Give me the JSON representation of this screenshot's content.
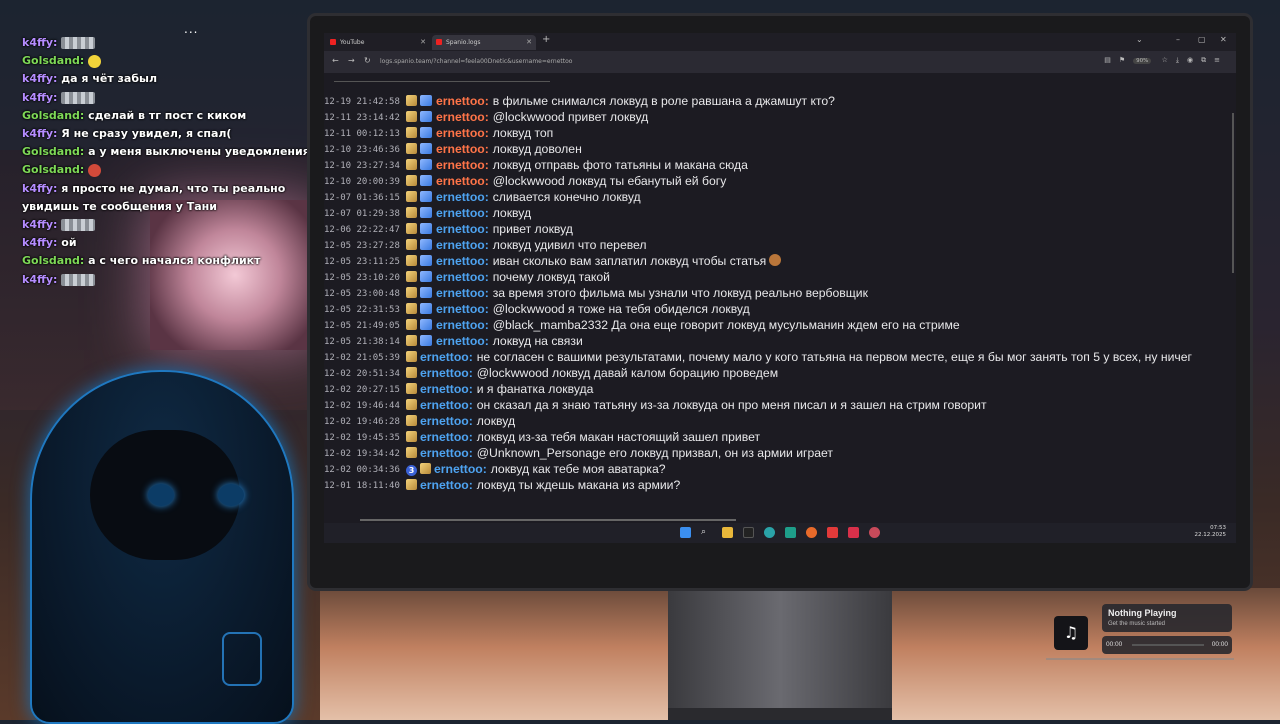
{
  "chat_overlay": {
    "dots": "...",
    "messages": [
      {
        "user": "k4ffy:",
        "color": "purple",
        "text": "",
        "emote": "gray"
      },
      {
        "user": "Golsdand:",
        "color": "green",
        "text": "",
        "emote": "yellow"
      },
      {
        "user": "k4ffy:",
        "color": "purple",
        "text": "да я чёт забыл",
        "emote": ""
      },
      {
        "user": "k4ffy:",
        "color": "purple",
        "text": "",
        "emote": "gray"
      },
      {
        "user": "Golsdand:",
        "color": "green",
        "text": "сделай в тг пост с киком",
        "emote": ""
      },
      {
        "user": "k4ffy:",
        "color": "purple",
        "text": "Я не сразу увидел, я спал(",
        "emote": ""
      },
      {
        "user": "Golsdand:",
        "color": "green",
        "text": "а у меня выключены уведомления",
        "emote": ""
      },
      {
        "user": "Golsdand:",
        "color": "green",
        "text": "",
        "emote": "red"
      },
      {
        "user": "k4ffy:",
        "color": "purple",
        "text": "я просто не думал, что ты реально увидишь те сообщения у Тани",
        "emote": ""
      },
      {
        "user": "k4ffy:",
        "color": "purple",
        "text": "",
        "emote": "gray"
      },
      {
        "user": "k4ffy:",
        "color": "purple",
        "text": "ой",
        "emote": ""
      },
      {
        "user": "Golsdand:",
        "color": "green",
        "text": "а с чего начался конфликт",
        "emote": ""
      },
      {
        "user": "k4ffy:",
        "color": "purple",
        "text": "",
        "emote": "gray"
      }
    ]
  },
  "browser": {
    "tabs": [
      {
        "label": "YouTube",
        "active": false
      },
      {
        "label": "Spanio.logs",
        "active": true
      }
    ],
    "new_tab": "+",
    "url": "logs.spanio.team/?channel=feela00Dnetic&username=ernettoo",
    "zoom": "90%",
    "window_controls": {
      "minimize": "–",
      "maximize": "▢",
      "close": "✕"
    }
  },
  "logs": [
    {
      "ts": "12-19 21:42:58",
      "badges": [
        "sub",
        "mod"
      ],
      "user": "ernettoo:",
      "color": "orange",
      "text": "в фильме снимался локвуд в роле равшана а джамшут кто?"
    },
    {
      "ts": "12-11 23:14:42",
      "badges": [
        "sub",
        "mod"
      ],
      "user": "ernettoo:",
      "color": "orange",
      "text": "@lockwwood привет локвуд"
    },
    {
      "ts": "12-11 00:12:13",
      "badges": [
        "sub",
        "mod"
      ],
      "user": "ernettoo:",
      "color": "orange",
      "text": "локвуд топ"
    },
    {
      "ts": "12-10 23:46:36",
      "badges": [
        "sub",
        "mod"
      ],
      "user": "ernettoo:",
      "color": "orange",
      "text": "локвуд доволен"
    },
    {
      "ts": "12-10 23:27:34",
      "badges": [
        "sub",
        "mod"
      ],
      "user": "ernettoo:",
      "color": "orange",
      "text": "локвуд отправь фото татьяны и макана сюда"
    },
    {
      "ts": "12-10 20:00:39",
      "badges": [
        "sub",
        "mod"
      ],
      "user": "ernettoo:",
      "color": "orange",
      "text": "@lockwwood локвуд ты ебанутый ей богу"
    },
    {
      "ts": "12-07 01:36:15",
      "badges": [
        "sub",
        "mod"
      ],
      "user": "ernettoo:",
      "color": "blue",
      "text": "сливается конечно локвуд"
    },
    {
      "ts": "12-07 01:29:38",
      "badges": [
        "sub",
        "mod"
      ],
      "user": "ernettoo:",
      "color": "blue",
      "text": "локвуд"
    },
    {
      "ts": "12-06 22:22:47",
      "badges": [
        "sub",
        "mod"
      ],
      "user": "ernettoo:",
      "color": "blue",
      "text": "привет локвуд"
    },
    {
      "ts": "12-05 23:27:28",
      "badges": [
        "sub",
        "mod"
      ],
      "user": "ernettoo:",
      "color": "blue",
      "text": "локвуд удивил что перевел"
    },
    {
      "ts": "12-05 23:11:25",
      "badges": [
        "sub",
        "mod"
      ],
      "user": "ernettoo:",
      "color": "blue",
      "text": "иван сколько вам заплатил локвуд чтобы статья",
      "emoji": true
    },
    {
      "ts": "12-05 23:10:20",
      "badges": [
        "sub",
        "mod"
      ],
      "user": "ernettoo:",
      "color": "blue",
      "text": "почему локвуд такой"
    },
    {
      "ts": "12-05 23:00:48",
      "badges": [
        "sub",
        "mod"
      ],
      "user": "ernettoo:",
      "color": "blue",
      "text": "за время этого фильма мы узнали что локвуд реально вербовщик"
    },
    {
      "ts": "12-05 22:31:53",
      "badges": [
        "sub",
        "mod"
      ],
      "user": "ernettoo:",
      "color": "blue",
      "text": "@lockwwood я тоже на тебя обиделся локвуд"
    },
    {
      "ts": "12-05 21:49:05",
      "badges": [
        "sub",
        "mod"
      ],
      "user": "ernettoo:",
      "color": "blue",
      "text": "@black_mamba2332 Да она еще говорит локвуд мусульманин ждем его на стриме"
    },
    {
      "ts": "12-05 21:38:14",
      "badges": [
        "sub",
        "mod"
      ],
      "user": "ernettoo:",
      "color": "blue",
      "text": "локвуд на связи"
    },
    {
      "ts": "12-02 21:05:39",
      "badges": [
        "sub"
      ],
      "user": "ernettoo:",
      "color": "blue",
      "text": "не согласен с вашими результатами, почему мало у кого татьяна на первом месте, еще я бы мог занять топ 5 у всех, ну ничег"
    },
    {
      "ts": "12-02 20:51:34",
      "badges": [
        "sub"
      ],
      "user": "ernettoo:",
      "color": "blue",
      "text": "@lockwwood локвуд давай калом борацию проведем"
    },
    {
      "ts": "12-02 20:27:15",
      "badges": [
        "sub"
      ],
      "user": "ernettoo:",
      "color": "blue",
      "text": "и я фанатка локвуда"
    },
    {
      "ts": "12-02 19:46:44",
      "badges": [
        "sub"
      ],
      "user": "ernettoo:",
      "color": "blue",
      "text": "он сказал да я знаю татьяну из-за локвуда он про меня писал и я зашел на стрим говорит"
    },
    {
      "ts": "12-02 19:46:28",
      "badges": [
        "sub"
      ],
      "user": "ernettoo:",
      "color": "blue",
      "text": "локвуд"
    },
    {
      "ts": "12-02 19:45:35",
      "badges": [
        "sub"
      ],
      "user": "ernettoo:",
      "color": "blue",
      "text": "локвуд из-за тебя макан настоящий зашел привет"
    },
    {
      "ts": "12-02 19:34:42",
      "badges": [
        "sub"
      ],
      "user": "ernettoo:",
      "color": "blue",
      "text": "@Unknown_Personage его локвуд призвал, он из армии играет"
    },
    {
      "ts": "12-02 00:34:36",
      "badges": [
        "num",
        "sub"
      ],
      "num": "3",
      "user": "ernettoo:",
      "color": "blue",
      "text": "локвуд как тебе моя аватарка?"
    },
    {
      "ts": "12-01 18:11:40",
      "badges": [
        "sub"
      ],
      "user": "ernettoo:",
      "color": "blue",
      "text": "локвуд ты ждешь макана из армии?"
    }
  ],
  "taskbar": {
    "time": "07:53",
    "date": "22.12.2025"
  },
  "music": {
    "icon": "♫",
    "title": "Nothing Playing",
    "subtitle": "Get the music started",
    "time_start": "00:00",
    "time_end": "00:00"
  },
  "colors": {
    "user_orange": "#ff7448",
    "user_blue": "#4ea3f0",
    "chat_purple": "#b58cff",
    "chat_green": "#7ed957"
  }
}
